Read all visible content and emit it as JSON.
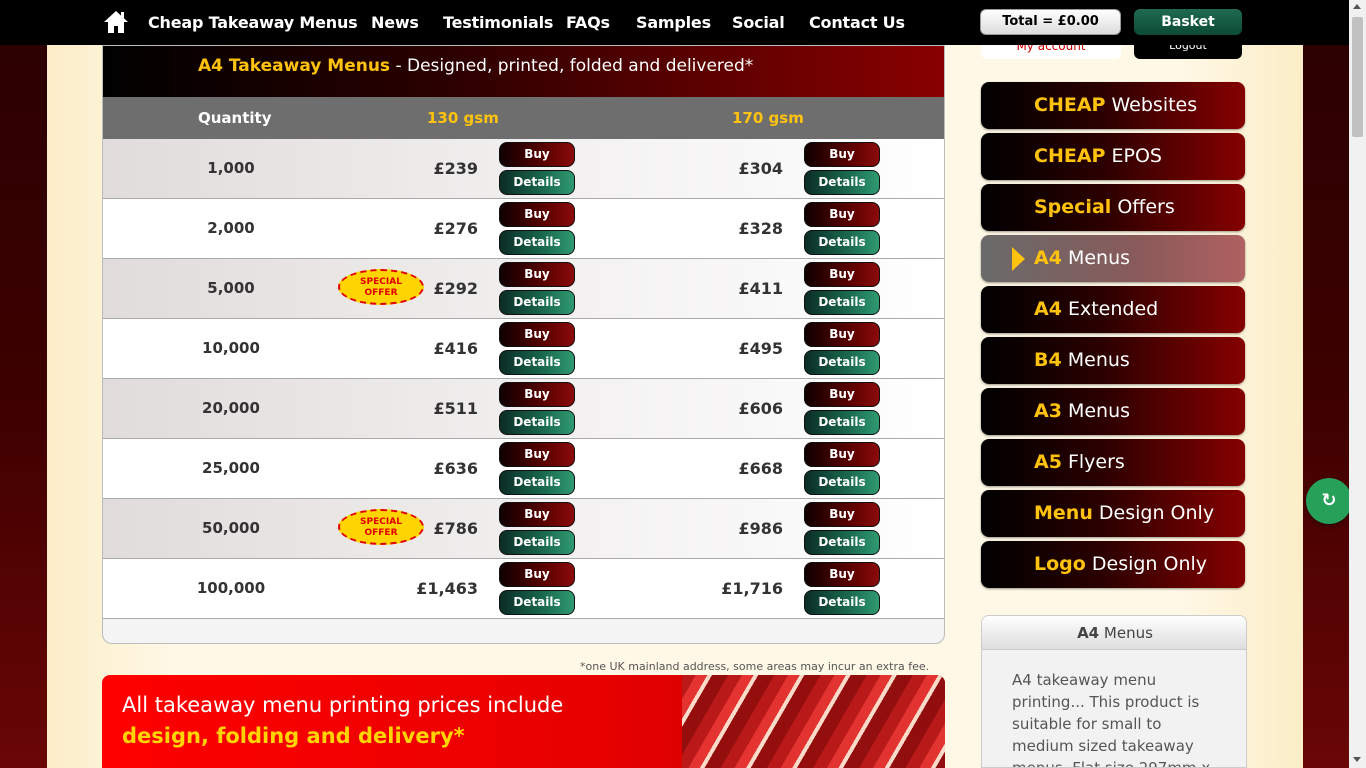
{
  "nav": {
    "links": [
      "Cheap Takeaway Menus",
      "News",
      "Testimonials",
      "FAQs",
      "Samples",
      "Social",
      "Contact Us"
    ],
    "total": "Total = £0.00",
    "basket": "Basket",
    "account": "My account",
    "logout": "Logout"
  },
  "card": {
    "title_bold": "A4 Takeaway Menus",
    "title_rest": " - Designed, printed, folded and delivered*",
    "col_quantity": "Quantity",
    "col_130": "130 gsm",
    "col_170": "170 gsm",
    "buy_label": "Buy",
    "details_label": "Details",
    "special_line1": "SPECIAL",
    "special_line2": "OFFER",
    "rows": [
      {
        "qty": "1,000",
        "p130": "£239",
        "p170": "£304"
      },
      {
        "qty": "2,000",
        "p130": "£276",
        "p170": "£328"
      },
      {
        "qty": "5,000",
        "p130": "£292",
        "p170": "£411"
      },
      {
        "qty": "10,000",
        "p130": "£416",
        "p170": "£495"
      },
      {
        "qty": "20,000",
        "p130": "£511",
        "p170": "£606"
      },
      {
        "qty": "25,000",
        "p130": "£636",
        "p170": "£668"
      },
      {
        "qty": "50,000",
        "p130": "£786",
        "p170": "£986"
      },
      {
        "qty": "100,000",
        "p130": "£1,463",
        "p170": "£1,716"
      }
    ],
    "footnote": "*one UK mainland address, some areas may incur an extra fee."
  },
  "banner": {
    "line1": "All takeaway menu printing prices include",
    "line2": "design, folding and delivery*"
  },
  "sidebar": {
    "items": [
      {
        "bold": "CHEAP",
        "rest": " Websites"
      },
      {
        "bold": "CHEAP",
        "rest": " EPOS"
      },
      {
        "bold": "Special",
        "rest": " Offers"
      },
      {
        "bold": "A4",
        "rest": " Menus"
      },
      {
        "bold": "A4",
        "rest": " Extended"
      },
      {
        "bold": "B4",
        "rest": " Menus"
      },
      {
        "bold": "A3",
        "rest": " Menus"
      },
      {
        "bold": "A5",
        "rest": " Flyers"
      },
      {
        "bold": "Menu",
        "rest": " Design Only"
      },
      {
        "bold": "Logo",
        "rest": " Design Only"
      }
    ],
    "info_title_bold": "A4",
    "info_title_rest": " Menus",
    "info_text": "A4 takeaway menu printing... This product is suitable for small to medium sized takeaway menus. Flat size 297mm x"
  },
  "float_button": "↻",
  "colors": {
    "accent_yellow": "#ffc20e",
    "dark_red": "#850000",
    "green": "#1b6a50"
  }
}
